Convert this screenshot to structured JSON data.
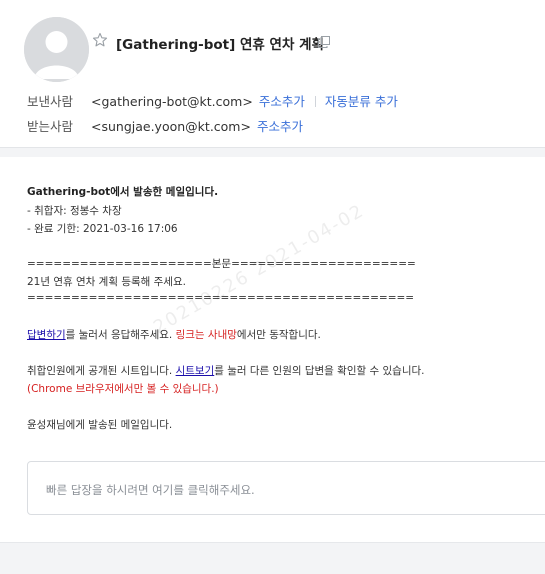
{
  "header": {
    "subject": "[Gathering-bot] 연휴 연차 계획",
    "from_label": "보낸사람",
    "from_address": "<gathering-bot@kt.com>",
    "from_add_contact": "주소추가",
    "from_auto_sort": "자동분류 추가",
    "to_label": "받는사람",
    "to_address": "<sungjae.yoon@kt.com>",
    "to_add_contact": "주소추가"
  },
  "mail": {
    "line1": "Gathering-bot에서 발송한 메일입니다.",
    "line2": "- 취합자: 정봉수 차장",
    "line3": "- 완료 기한: 2021-03-16 17:06",
    "sep_top": "=====================본문=====================",
    "request": "21년 연휴 연차 계획 등록해 주세요.",
    "sep_bottom": "============================================",
    "reply_link": "답변하기",
    "reply_mid": "를 눌러서 응답해주세요. ",
    "reply_red": "링크는 사내망",
    "reply_end": "에서만 동작합니다.",
    "sheet_pre": "취합인원에게 공개된 시트입니다. ",
    "sheet_link": "시트보기",
    "sheet_end": "를 눌러 다른 인원의 답변을 확인할 수 있습니다.",
    "chrome_note": "(Chrome 브라우저에서만 볼 수 있습니다.)",
    "sent_to": "윤성재님에게 발송된 메일입니다."
  },
  "watermark": "20210226   2021-04-02",
  "quick_reply": {
    "placeholder": "빠른 답장을 하시려면 여기를 클릭해주세요."
  },
  "icons": {
    "avatar": "default-user-avatar",
    "star": "star-outline-icon",
    "copy": "copy-icon"
  },
  "colors": {
    "link_blue": "#3a6fd8",
    "hyperlink": "#1a0dab",
    "warning_red": "#d62020"
  }
}
